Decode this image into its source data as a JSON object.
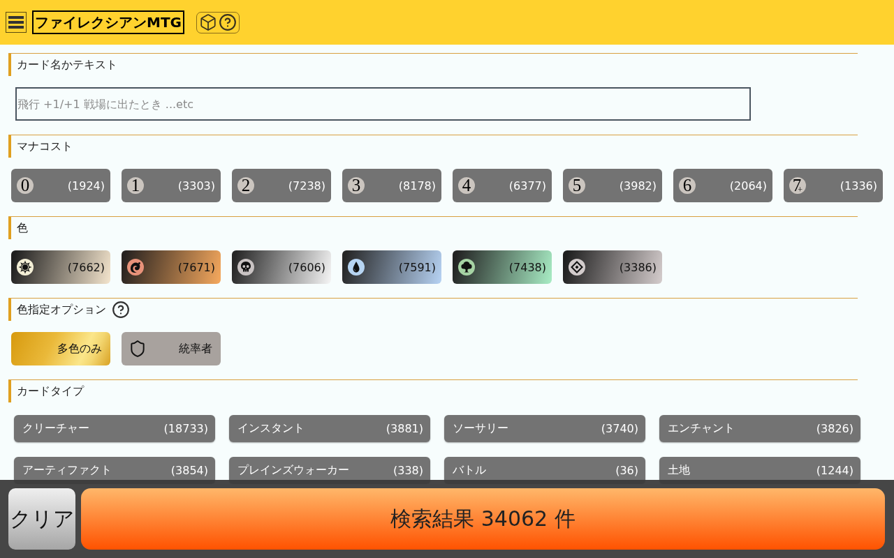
{
  "header": {
    "title": "ファイレクシアンMTG"
  },
  "text_search": {
    "heading": "カード名かテキスト",
    "placeholder": "飛行 +1/+1 戦場に出たとき ...etc"
  },
  "mana_cost": {
    "heading": "マナコスト",
    "buttons": [
      {
        "symbol": "0",
        "count": "(1924)"
      },
      {
        "symbol": "1",
        "count": "(3303)"
      },
      {
        "symbol": "2",
        "count": "(7238)"
      },
      {
        "symbol": "3",
        "count": "(8178)"
      },
      {
        "symbol": "4",
        "count": "(6377)"
      },
      {
        "symbol": "5",
        "count": "(3982)"
      },
      {
        "symbol": "6",
        "count": "(2064)"
      },
      {
        "symbol": "7$_{+}$",
        "count": "(1336)"
      }
    ]
  },
  "colors": {
    "heading": "色",
    "buttons": [
      {
        "kind": "white",
        "count": "(7662)"
      },
      {
        "kind": "red",
        "count": "(7671)"
      },
      {
        "kind": "black",
        "count": "(7606)"
      },
      {
        "kind": "blue",
        "count": "(7591)"
      },
      {
        "kind": "green",
        "count": "(7438)"
      },
      {
        "kind": "colorless",
        "count": "(3386)"
      }
    ]
  },
  "color_options": {
    "heading": "色指定オプション",
    "buttons": [
      {
        "kind": "multicolor",
        "label": "多色のみ"
      },
      {
        "kind": "commander",
        "label": "統率者"
      }
    ]
  },
  "card_types": {
    "heading": "カードタイプ",
    "buttons": [
      {
        "label": "クリーチャー",
        "count": "(18733)"
      },
      {
        "label": "インスタント",
        "count": "(3881)"
      },
      {
        "label": "ソーサリー",
        "count": "(3740)"
      },
      {
        "label": "エンチャント",
        "count": "(3826)"
      },
      {
        "label": "アーティファクト",
        "count": "(3854)"
      },
      {
        "label": "プレインズウォーカー",
        "count": "(338)"
      },
      {
        "label": "バトル",
        "count": "(36)"
      },
      {
        "label": "土地",
        "count": "(1244)"
      }
    ]
  },
  "footer": {
    "clear": "クリア",
    "search": "検索結果 34062 件"
  }
}
